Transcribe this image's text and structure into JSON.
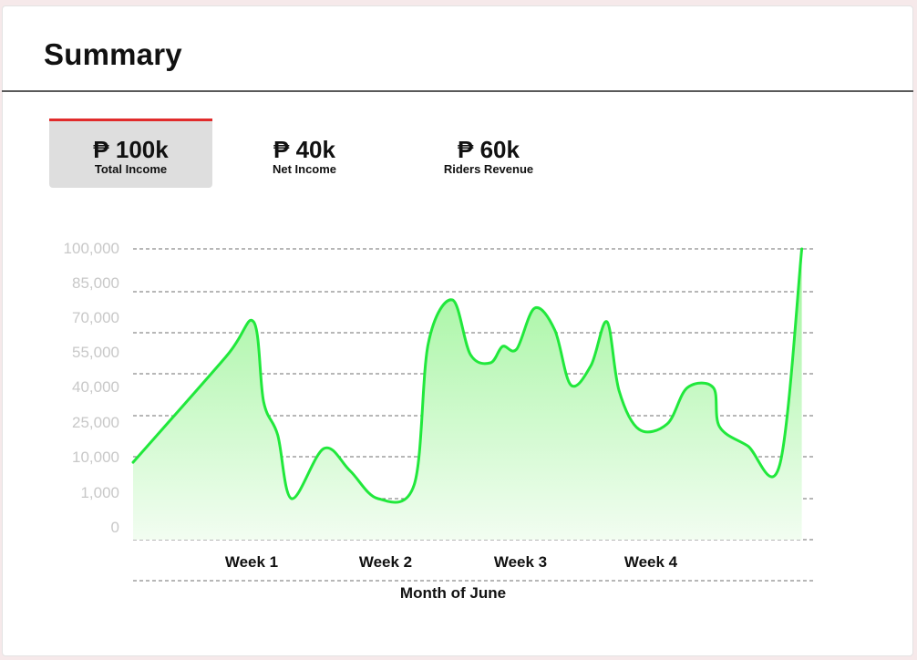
{
  "header": {
    "title": "Summary"
  },
  "tabs": [
    {
      "amount": "₱ 100k",
      "label": "Total Income",
      "active": true
    },
    {
      "amount": "₱ 40k",
      "label": "Net Income",
      "active": false
    },
    {
      "amount": "₱ 60k",
      "label": "Riders Revenue",
      "active": false
    }
  ],
  "colors": {
    "accent": "#e12b2b",
    "line": "#21e83c",
    "fill_top": "#9ef59a",
    "fill_bottom": "#f2fdf1"
  },
  "chart_data": {
    "type": "area",
    "title": "",
    "xlabel": "Month of June",
    "ylabel": "",
    "y_ticks": [
      "100,000",
      "85,000",
      "70,000",
      "55,000",
      "40,000",
      "25,000",
      "10,000",
      "1,000",
      "0"
    ],
    "x_ticks": [
      "Week 1",
      "Week 2",
      "Week 3",
      "Week 4"
    ],
    "grid": true,
    "series": [
      {
        "values": [
          {
            "x": 0.0,
            "y": 23000
          },
          {
            "x": 2.3,
            "y": 61000
          },
          {
            "x": 3.0,
            "y": 74000
          },
          {
            "x": 3.25,
            "y": 45000
          },
          {
            "x": 3.6,
            "y": 33000
          },
          {
            "x": 3.95,
            "y": 1000
          },
          {
            "x": 4.75,
            "y": 28000
          },
          {
            "x": 5.4,
            "y": 20000
          },
          {
            "x": 6.1,
            "y": 9000
          },
          {
            "x": 7.0,
            "y": 15000
          },
          {
            "x": 7.35,
            "y": 66000
          },
          {
            "x": 7.95,
            "y": 82000
          },
          {
            "x": 8.4,
            "y": 62000
          },
          {
            "x": 8.9,
            "y": 59000
          },
          {
            "x": 9.2,
            "y": 65000
          },
          {
            "x": 9.55,
            "y": 64000
          },
          {
            "x": 10.0,
            "y": 79000
          },
          {
            "x": 10.5,
            "y": 71000
          },
          {
            "x": 10.9,
            "y": 51000
          },
          {
            "x": 11.4,
            "y": 58000
          },
          {
            "x": 11.8,
            "y": 74000
          },
          {
            "x": 12.1,
            "y": 49000
          },
          {
            "x": 12.6,
            "y": 35000
          },
          {
            "x": 13.3,
            "y": 37000
          },
          {
            "x": 13.8,
            "y": 50000
          },
          {
            "x": 14.45,
            "y": 50000
          },
          {
            "x": 14.6,
            "y": 36000
          },
          {
            "x": 15.3,
            "y": 29000
          },
          {
            "x": 16.1,
            "y": 22000
          },
          {
            "x": 16.65,
            "y": 100000
          }
        ]
      }
    ]
  }
}
